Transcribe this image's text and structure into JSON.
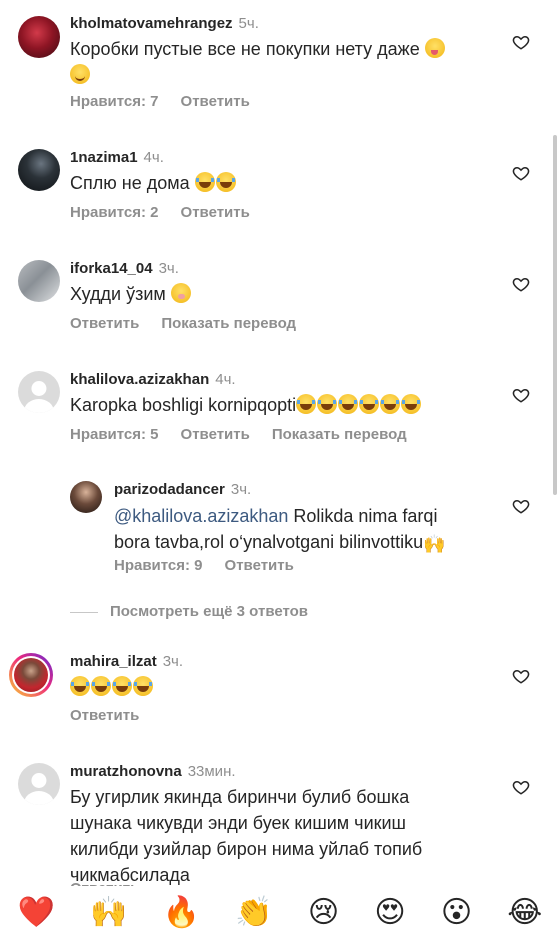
{
  "comments": [
    {
      "username": "kholmatovamehrangez",
      "time": "5ч.",
      "text": "Коробки пустые все не покупки нету даже",
      "likes_label": "Нравится: 7",
      "reply_label": "Ответить"
    },
    {
      "username": "1nazima1",
      "time": "4ч.",
      "text": "Сплю не дома",
      "likes_label": "Нравится: 2",
      "reply_label": "Ответить"
    },
    {
      "username": "iforka14_04",
      "time": "3ч.",
      "text": "Худди ўзим",
      "reply_label": "Ответить",
      "translate_label": "Показать перевод"
    },
    {
      "username": "khalilova.azizakhan",
      "time": "4ч.",
      "text": "Karopka boshligi kornipqopti",
      "likes_label": "Нравится: 5",
      "reply_label": "Ответить",
      "translate_label": "Показать перевод"
    },
    {
      "username": "parizodadancer",
      "time": "3ч.",
      "mention": "@khalilova.azizakhan",
      "text_line1": " Rolikda nima farqi",
      "text_line2": "bora tavba,rol o‘ynalvotgani bilinvottiku",
      "likes_label": "Нравится: 9",
      "reply_label": "Ответить"
    },
    {
      "username": "mahira_ilzat",
      "time": "3ч.",
      "reply_label": "Ответить"
    },
    {
      "username": "muratzhonovna",
      "time": "33мин.",
      "text_line1": "Бу угирлик якинда биринчи булиб бошка",
      "text_line2": "шунака чикувди энди буек кишим чикиш",
      "text_line3": "килибди узийлар бирон нима уйлаб топиб",
      "text_line4": "чикмабсилада",
      "reply_label": "Ответить"
    }
  ],
  "view_more_replies": "Посмотреть ещё 3 ответов",
  "reaction_bar": [
    "❤️",
    "🙌",
    "🔥",
    "👏",
    "😢",
    "😍",
    "😮",
    "😂"
  ],
  "icons": {
    "like": "heart-outline-icon"
  },
  "colors": {
    "text": "#262626",
    "secondary": "#8e8e8e",
    "mention": "#3d5a80"
  }
}
